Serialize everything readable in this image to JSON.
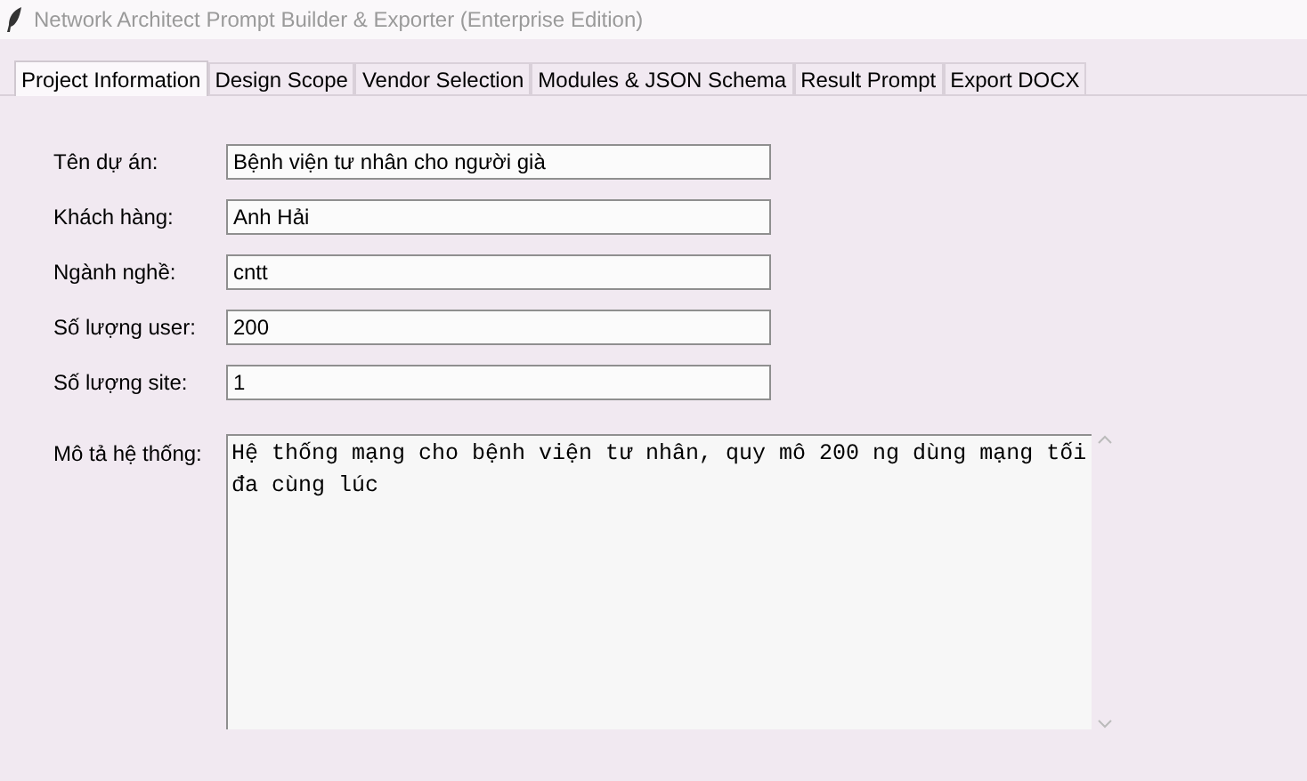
{
  "window": {
    "title": "Network Architect Prompt Builder & Exporter (Enterprise Edition)"
  },
  "tabs": [
    {
      "label": "Project Information",
      "selected": true
    },
    {
      "label": "Design Scope",
      "selected": false
    },
    {
      "label": "Vendor Selection",
      "selected": false
    },
    {
      "label": "Modules & JSON Schema",
      "selected": false
    },
    {
      "label": "Result Prompt",
      "selected": false
    },
    {
      "label": "Export DOCX",
      "selected": false
    }
  ],
  "fields": [
    {
      "label": "Tên dự án:",
      "value": "Bệnh viện tư nhân cho người già"
    },
    {
      "label": "Khách hàng:",
      "value": "Anh Hải"
    },
    {
      "label": "Ngành nghề:",
      "value": "cntt"
    },
    {
      "label": "Số lượng user:",
      "value": "200"
    },
    {
      "label": "Số lượng site:",
      "value": "1"
    }
  ],
  "description": {
    "label": "Mô tả hệ thống:",
    "value": "Hệ thống mạng cho bệnh viện tư nhân, quy mô 200 ng dùng mạng tối đa cùng lúc"
  }
}
